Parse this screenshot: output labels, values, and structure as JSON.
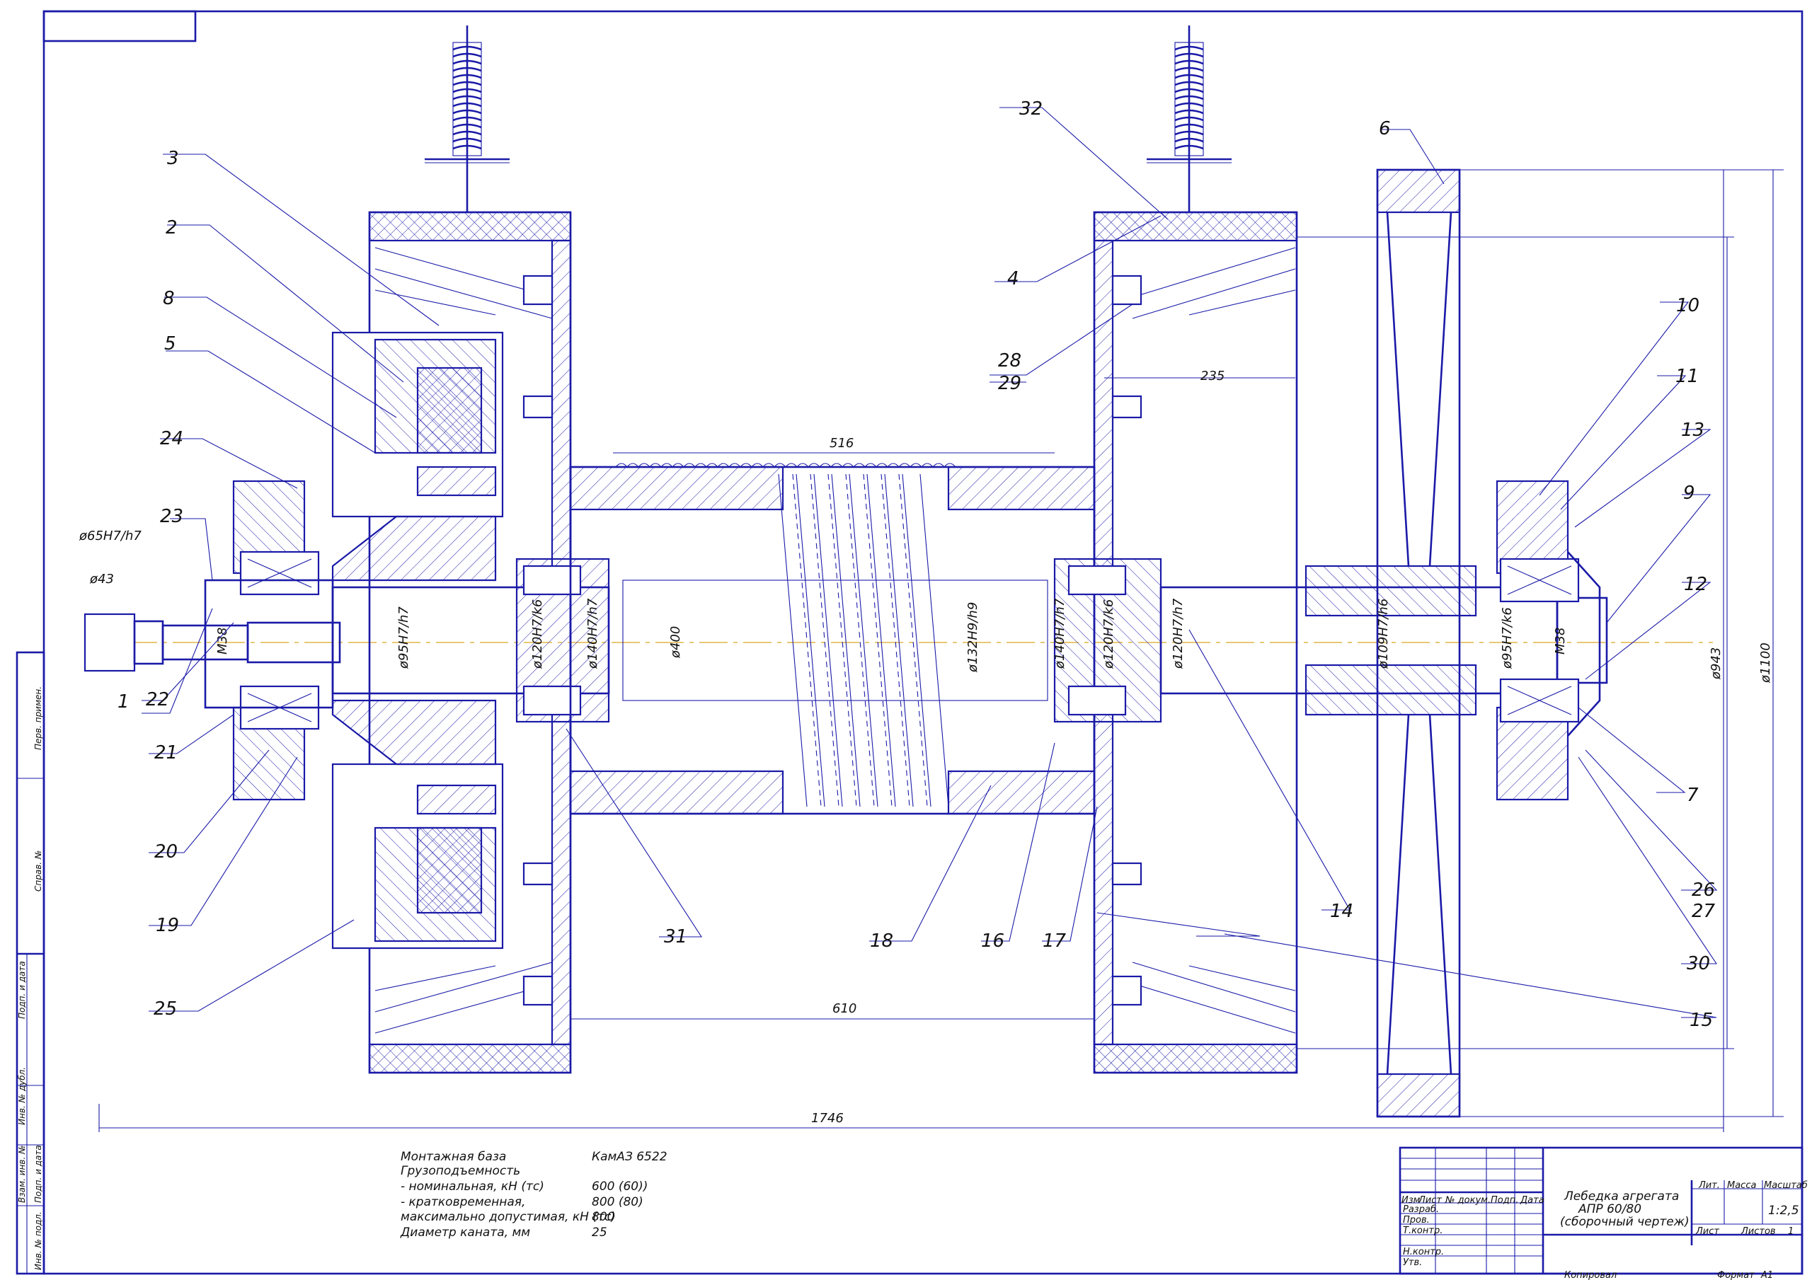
{
  "drawing": {
    "part_numbers": [
      "1",
      "2",
      "3",
      "4",
      "5",
      "6",
      "7",
      "8",
      "9",
      "10",
      "11",
      "12",
      "13",
      "14",
      "15",
      "16",
      "17",
      "18",
      "19",
      "20",
      "21",
      "22",
      "23",
      "24",
      "25",
      "26",
      "27",
      "28",
      "29",
      "30",
      "31",
      "32"
    ],
    "dimensions": {
      "d65": "ø65H7/h7",
      "d43": "ø43",
      "m38a": "М38",
      "d95a": "ø95H7/h7",
      "d120a": "ø120H7/k6",
      "d140a": "ø140H7/h7",
      "d400": "ø400",
      "d132": "ø132H9/h9",
      "d140b": "ø140H7/h7",
      "d120b": "ø120H7/k6",
      "d120c": "ø120H7/h7",
      "d109": "ø109H7/h6",
      "d95b": "ø95H7/k6",
      "m38b": "М38",
      "d943": "ø943",
      "d1100": "ø1100",
      "l516": "516",
      "l235": "235",
      "l610": "610",
      "l1746": "1746"
    }
  },
  "spec_notes": [
    {
      "label": "Монтажная база",
      "value": "КамАЗ 6522"
    },
    {
      "label": "Грузоподъемность",
      "value": ""
    },
    {
      "label": "- номинальная, кН (тс)",
      "value": "600 (60))"
    },
    {
      "label": "- кратковременная,",
      "value": "800 (80)"
    },
    {
      "label": "максимально допустимая, кН (тс)",
      "value": "800"
    },
    {
      "label": "Диаметр каната, мм",
      "value": "25"
    }
  ],
  "title_block": {
    "name_line1": "Лебедка агрегата",
    "name_line2": "АПР 60/80",
    "name_line3": "(сборочный чертеж)",
    "col_izm": "Изм",
    "col_list": "Лист",
    "col_ndok": "№ докум.",
    "col_podp": "Подп.",
    "col_data": "Дата",
    "row_razrab": "Разраб.",
    "row_prov": "Пров.",
    "row_tkontr": "Т.контр.",
    "row_nkontr": "Н.контр.",
    "row_utv": "Утв.",
    "hdr_lit": "Лит.",
    "hdr_massa": "Масса",
    "hdr_masshtab": "Масштаб",
    "scale": "1:2,5",
    "sheet_label": "Лист",
    "sheets_label": "Листов",
    "sheets_value": "1",
    "copied": "Копировал",
    "format_label": "Формат",
    "format_value": "А1"
  },
  "side_stamp": {
    "perv_primen": "Перв. примен.",
    "sprav": "Справ. №",
    "podp_data1": "Подп. и дата",
    "inv_dubl": "Инв. № дубл.",
    "vzam_inv": "Взам. инв. №",
    "podp_data2": "Подп. и дата",
    "inv_podl": "Инв. № подл."
  }
}
